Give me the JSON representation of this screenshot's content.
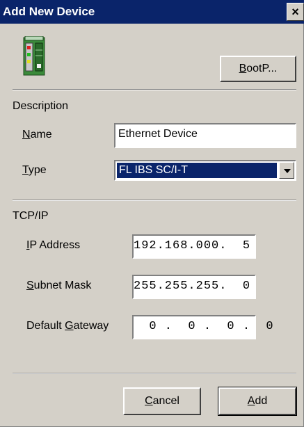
{
  "window": {
    "title": "Add New Device",
    "close_glyph": "×"
  },
  "icon": {
    "name": "device-module-icon"
  },
  "buttons": {
    "bootp": "BootP...",
    "cancel": "Cancel",
    "add": "Add"
  },
  "description": {
    "heading": "Description",
    "name_label": "Name",
    "name_value": "Ethernet Device",
    "type_label": "Type",
    "type_value": "FL IBS SC/I-T"
  },
  "tcpip": {
    "heading": "TCP/IP",
    "ip_label": "IP Address",
    "ip_value": "192.168.000.  5",
    "subnet_label": "Subnet Mask",
    "subnet_value": "255.255.255.  0",
    "gateway_label": "Default Gateway",
    "gateway_value": "  0 .  0 .  0 .  0"
  }
}
